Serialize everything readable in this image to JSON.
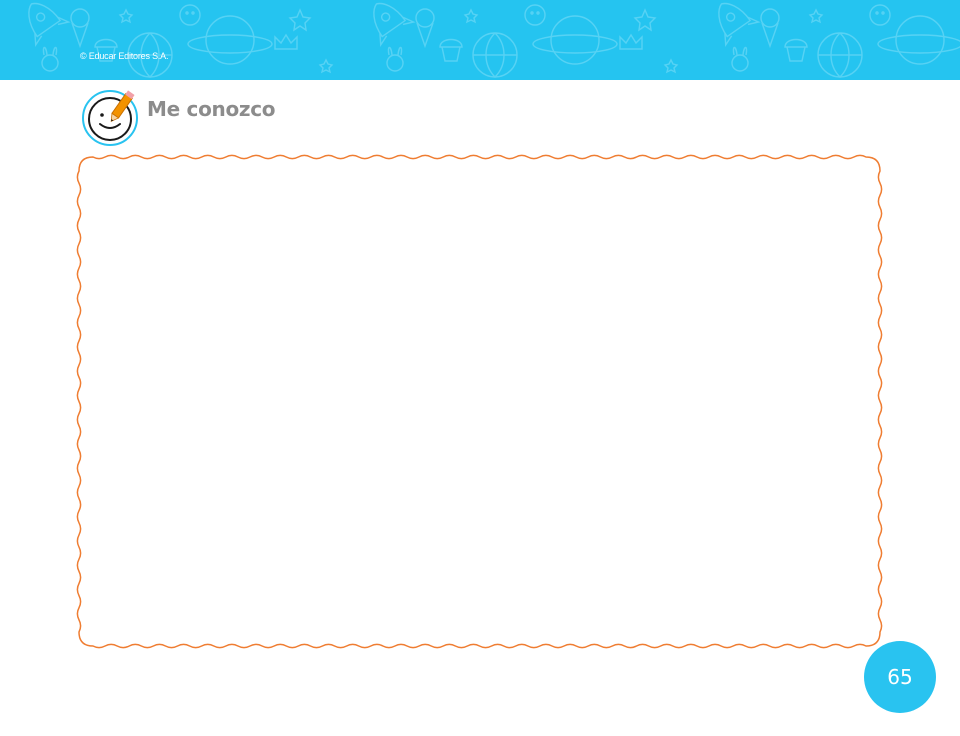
{
  "header": {
    "copyright": "© Educar Editores S.A.",
    "background_color": "#25c4f0",
    "pattern_icons": [
      "rocket-icon",
      "planet-icon",
      "globe-icon",
      "ice-cream-icon",
      "star-icon",
      "bunny-icon",
      "cupcake-icon",
      "crown-icon",
      "moon-icon"
    ]
  },
  "section": {
    "title": "Me conozco",
    "icon": "smiley-pencil-icon",
    "icon_ring_color": "#29c3f0",
    "pencil_color": "#f39200"
  },
  "frame": {
    "border_color": "#ef7d32",
    "style": "wavy"
  },
  "footer": {
    "page_number": "65",
    "badge_color": "#29c3f0"
  }
}
